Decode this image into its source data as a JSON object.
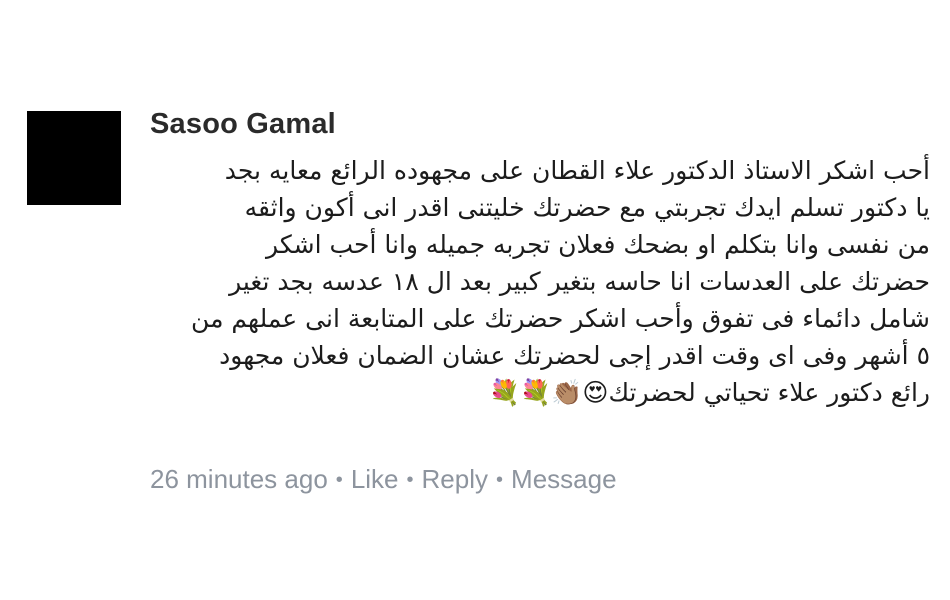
{
  "comment": {
    "author": "Sasoo Gamal",
    "lines": [
      "أحب اشكر الاستاذ الدكتور علاء القطان على مجهوده الرائع معايه بجد",
      "يا دكتور تسلم ايدك تجربتي مع حضرتك خليتنى اقدر انى أكون واثقه",
      "من نفسى وانا بتكلم او بضحك فعلان تجربه جميله وانا أحب اشكر",
      "حضرتك على العدسات انا حاسه بتغير كبير بعد ال ١٨ عدسه بجد تغير",
      "شامل دائماء فى تفوق وأحب اشكر حضرتك على المتابعة انى عملهم من",
      "٥ أشهر وفى اى وقت اقدر إجى لحضرتك عشان الضمان فعلان مجهود",
      "رائع دكتور علاء تحياتي لحضرتك😍👏🏽💐💐"
    ]
  },
  "actions": {
    "timestamp": "26 minutes ago",
    "like": "Like",
    "reply": "Reply",
    "message": "Message",
    "separator": "•"
  }
}
